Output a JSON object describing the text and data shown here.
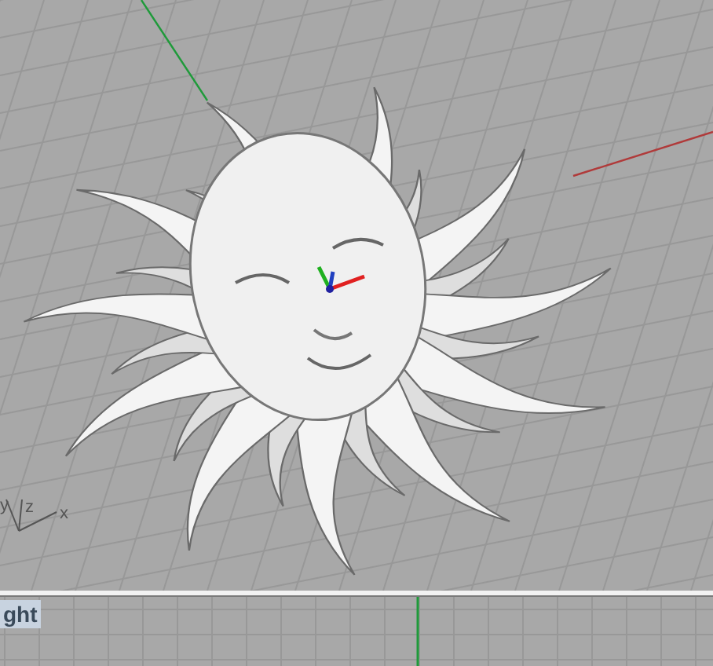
{
  "perspective_viewport": {
    "axis_labels": [
      "y",
      "z",
      "x"
    ]
  },
  "bottom_viewport": {
    "tab_label": "ght"
  }
}
